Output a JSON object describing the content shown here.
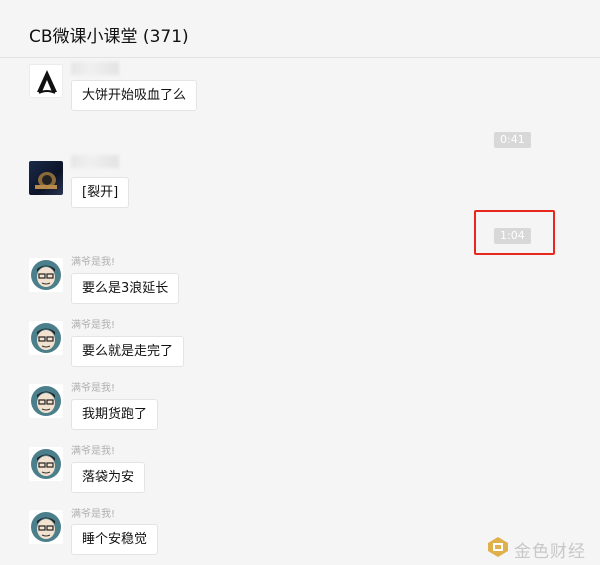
{
  "window": {
    "title": "CB微课小课堂 (371)"
  },
  "timestamps": [
    "0:41",
    "1:04"
  ],
  "messages": [
    {
      "sender": "",
      "text": "大饼开始吸血了么",
      "avatar": "assassins-logo-icon"
    },
    {
      "sender": "",
      "text": "[裂开]",
      "avatar": "watch-photo-avatar"
    },
    {
      "sender": "满爷是我!",
      "text": "要么是3浪延长",
      "avatar": "cartoon-man-avatar"
    },
    {
      "sender": "满爷是我!",
      "text": "要么就是走完了",
      "avatar": "cartoon-man-avatar"
    },
    {
      "sender": "满爷是我!",
      "text": "我期货跑了",
      "avatar": "cartoon-man-avatar"
    },
    {
      "sender": "满爷是我!",
      "text": "落袋为安",
      "avatar": "cartoon-man-avatar"
    },
    {
      "sender": "满爷是我!",
      "text": "睡个安稳觉",
      "avatar": "cartoon-man-avatar"
    }
  ],
  "watermark": {
    "text": "金色财经"
  },
  "colors": {
    "highlight": "#e8281e",
    "background": "#f5f5f5",
    "bubble": "#ffffff"
  }
}
